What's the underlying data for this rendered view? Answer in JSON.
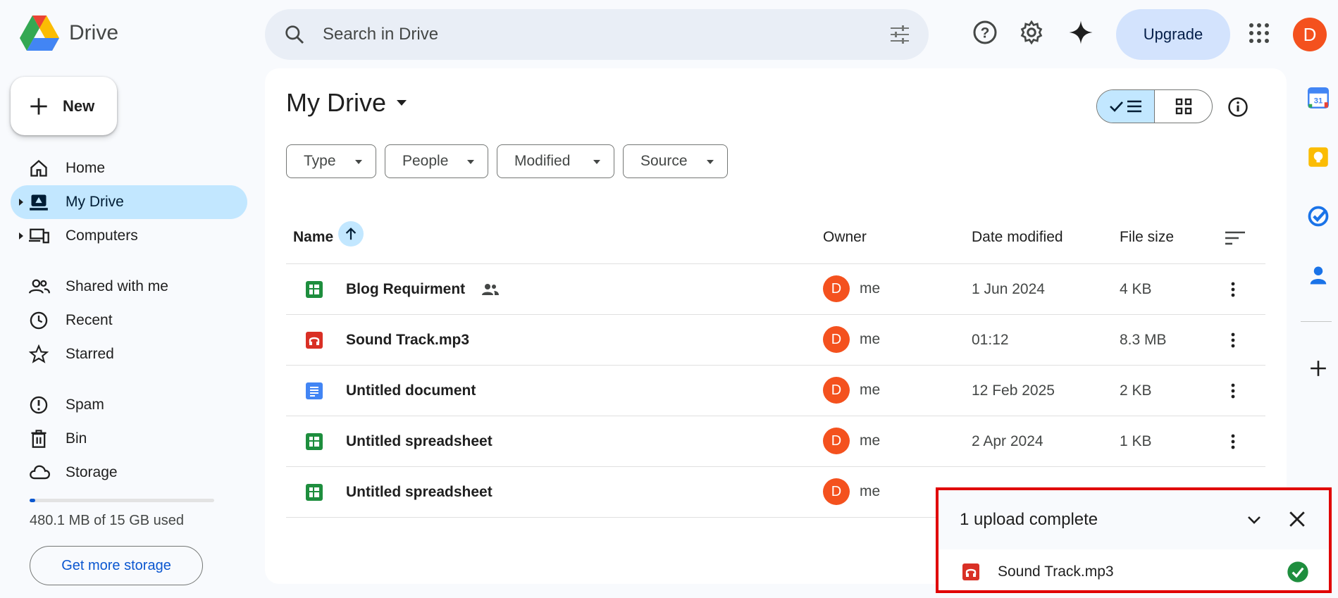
{
  "app": {
    "name": "Drive"
  },
  "search": {
    "placeholder": "Search in Drive",
    "value": ""
  },
  "header": {
    "upgrade_label": "Upgrade",
    "avatar_letter": "D"
  },
  "sidebar": {
    "new_label": "New",
    "items": [
      {
        "label": "Home",
        "icon": "home-icon"
      },
      {
        "label": "My Drive",
        "icon": "my-drive-icon",
        "active": true
      },
      {
        "label": "Computers",
        "icon": "computers-icon"
      },
      {
        "label": "Shared with me",
        "icon": "shared-icon"
      },
      {
        "label": "Recent",
        "icon": "clock-icon"
      },
      {
        "label": "Starred",
        "icon": "star-icon"
      },
      {
        "label": "Spam",
        "icon": "spam-icon"
      },
      {
        "label": "Bin",
        "icon": "trash-icon"
      },
      {
        "label": "Storage",
        "icon": "cloud-icon"
      }
    ],
    "storage_text": "480.1 MB of 15 GB used",
    "storage_fraction": 0.03,
    "get_storage_label": "Get more storage"
  },
  "main": {
    "title": "My Drive",
    "filters": [
      "Type",
      "People",
      "Modified",
      "Source"
    ],
    "columns": {
      "name": "Name",
      "owner": "Owner",
      "date": "Date modified",
      "size": "File size"
    },
    "rows": [
      {
        "name": "Blog Requirment",
        "type": "sheet",
        "shared": true,
        "owner": "me",
        "owner_letter": "D",
        "date": "1 Jun 2024",
        "size": "4 KB"
      },
      {
        "name": "Sound Track.mp3",
        "type": "audio",
        "shared": false,
        "owner": "me",
        "owner_letter": "D",
        "date": "01:12",
        "size": "8.3 MB"
      },
      {
        "name": "Untitled document",
        "type": "doc",
        "shared": false,
        "owner": "me",
        "owner_letter": "D",
        "date": "12 Feb 2025",
        "size": "2 KB"
      },
      {
        "name": "Untitled spreadsheet",
        "type": "sheet",
        "shared": false,
        "owner": "me",
        "owner_letter": "D",
        "date": "2 Apr 2024",
        "size": "1 KB"
      },
      {
        "name": "Untitled spreadsheet",
        "type": "sheet",
        "shared": false,
        "owner": "me",
        "owner_letter": "D",
        "date": "",
        "size": ""
      }
    ]
  },
  "upload": {
    "title": "1 upload complete",
    "item_name": "Sound Track.mp3"
  },
  "colors": {
    "accent": "#0b57d0",
    "active_nav": "#c2e7ff",
    "avatar": "#f4511e",
    "toast_border": "#e00000"
  }
}
